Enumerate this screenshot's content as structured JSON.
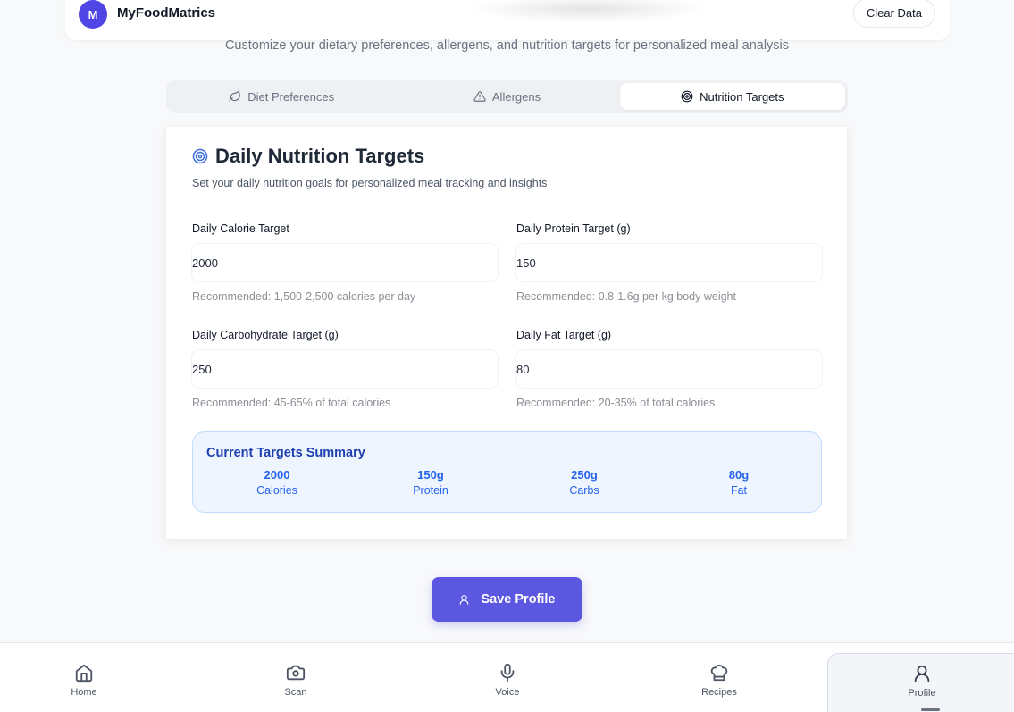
{
  "app": {
    "logo_letter": "M",
    "title": "MyFoodMatrics",
    "clear_label": "Clear Data"
  },
  "subtitle": "Customize your dietary preferences, allergens, and nutrition targets for personalized meal analysis",
  "tabs": [
    {
      "label": "Diet Preferences",
      "icon": "leaf-icon",
      "active": false
    },
    {
      "label": "Allergens",
      "icon": "warning-icon",
      "active": false
    },
    {
      "label": "Nutrition Targets",
      "icon": "target-icon",
      "active": true
    }
  ],
  "card": {
    "title": "Daily Nutrition Targets",
    "description": "Set your daily nutrition goals for personalized meal tracking and insights",
    "fields": {
      "calories": {
        "label": "Daily Calorie Target",
        "value": "2000",
        "hint": "Recommended: 1,500-2,500 calories per day"
      },
      "protein": {
        "label": "Daily Protein Target (g)",
        "value": "150",
        "hint": "Recommended: 0.8-1.6g per kg body weight"
      },
      "carbs": {
        "label": "Daily Carbohydrate Target (g)",
        "value": "250",
        "hint": "Recommended: 45-65% of total calories"
      },
      "fat": {
        "label": "Daily Fat Target (g)",
        "value": "80",
        "hint": "Recommended: 20-35% of total calories"
      }
    },
    "summary": {
      "title": "Current Targets Summary",
      "items": [
        {
          "value": "2000",
          "label": "Calories"
        },
        {
          "value": "150g",
          "label": "Protein"
        },
        {
          "value": "250g",
          "label": "Carbs"
        },
        {
          "value": "80g",
          "label": "Fat"
        }
      ]
    }
  },
  "save_label": "Save Profile",
  "nav": [
    {
      "label": "Home",
      "icon": "home-icon"
    },
    {
      "label": "Scan",
      "icon": "camera-icon"
    },
    {
      "label": "Voice",
      "icon": "microphone-icon"
    },
    {
      "label": "Recipes",
      "icon": "chef-hat-icon"
    },
    {
      "label": "Profile",
      "icon": "user-icon",
      "active": true
    }
  ],
  "colors": {
    "accent": "#5b57e0",
    "logo": "#4f46e5",
    "summary_text": "#2563eb",
    "summary_bg": "#eef5ff"
  }
}
